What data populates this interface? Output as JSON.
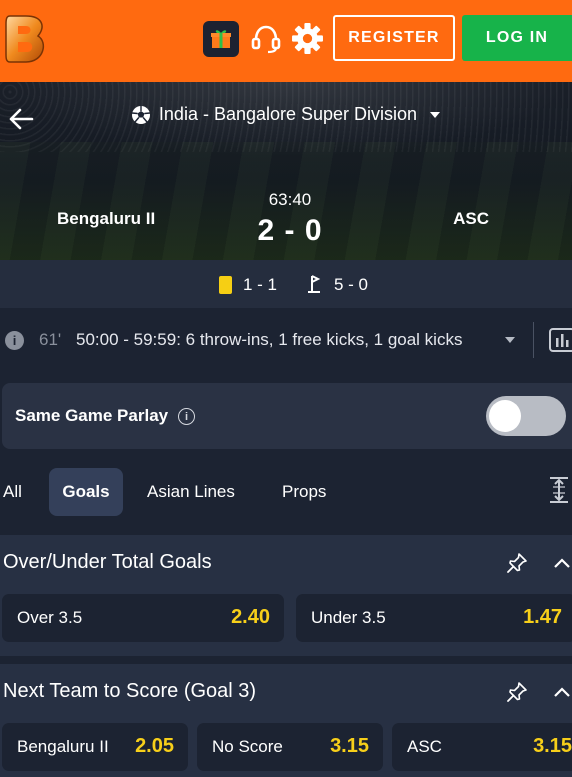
{
  "header": {
    "register_label": "REGISTER",
    "login_label": "LOG IN",
    "brand_color": "#ff6a10",
    "login_color": "#17b34a"
  },
  "match": {
    "league": "India - Bangalore Super Division",
    "home_team": "Bengaluru  II",
    "away_team": "ASC",
    "clock": "63:40",
    "score": "2 - 0"
  },
  "stats": {
    "cards": "1 - 1",
    "corners": "5 - 0"
  },
  "commentary": {
    "info_glyph": "i",
    "minute": "61'",
    "text": "50:00 - 59:59: 6 throw-ins, 1 free kicks, 1 goal kicks"
  },
  "sgp": {
    "label": "Same Game Parlay",
    "info_glyph": "i",
    "enabled": false
  },
  "tabs": [
    {
      "label": "All",
      "active": false
    },
    {
      "label": "Goals",
      "active": true
    },
    {
      "label": "Asian Lines",
      "active": false
    },
    {
      "label": "Props",
      "active": false
    }
  ],
  "markets": [
    {
      "title": "Over/Under Total Goals",
      "odds": [
        {
          "label": "Over 3.5",
          "value": "2.40"
        },
        {
          "label": "Under 3.5",
          "value": "1.47"
        }
      ]
    },
    {
      "title": "Next Team to Score (Goal 3)",
      "odds": [
        {
          "label": "Bengaluru II",
          "value": "2.05"
        },
        {
          "label": "No Score",
          "value": "3.15"
        },
        {
          "label": "ASC",
          "value": "3.15"
        }
      ]
    }
  ],
  "icons": {
    "logo": "brand-logo",
    "gift": "gift-icon",
    "support": "headset-icon",
    "settings": "gear-icon",
    "back": "back-arrow-icon",
    "sport": "soccer-ball-icon",
    "yellow_card": "yellow-card-icon",
    "corner": "corner-flag-icon",
    "stats": "bar-chart-icon",
    "pin": "pin-icon",
    "collapse": "chevron-up-icon"
  },
  "colors": {
    "odds_value": "#f7cf1a",
    "background": "#1c2332",
    "card_yellow": "#f6cf14"
  }
}
